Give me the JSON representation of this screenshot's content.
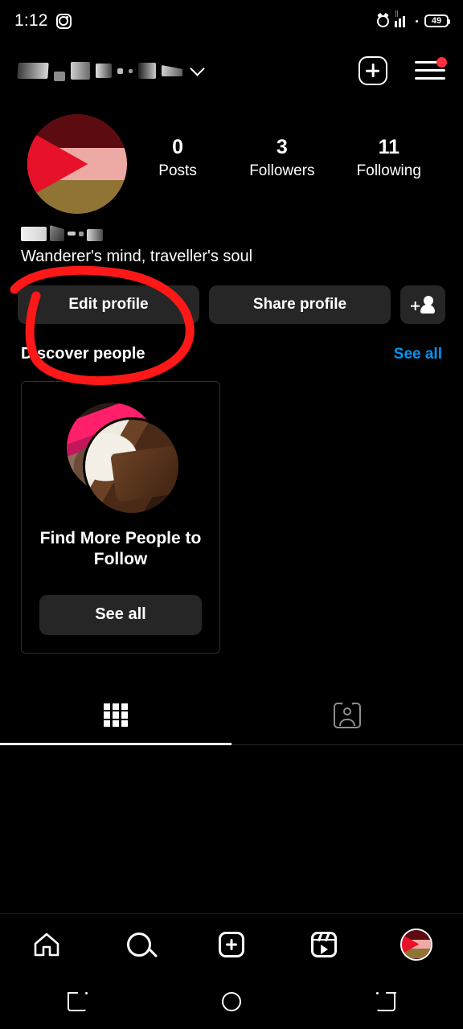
{
  "status_bar": {
    "time": "1:12",
    "app_icon": "instagram-icon",
    "alarm_icon": "alarm-clock-icon",
    "signal_icon": "signal-bars-icon",
    "signal_label": "WiFi",
    "battery_level": "49"
  },
  "header": {
    "username": "",
    "username_redacted": true,
    "chevron_icon": "chevron-down-icon",
    "add_icon": "plus-square-icon",
    "menu_icon": "hamburger-menu-icon",
    "menu_badge": true,
    "badge_color": "#ff3040"
  },
  "profile": {
    "avatar_icon": "profile-avatar",
    "avatar_colors": {
      "top": "#5c0b10",
      "middle": "#eda9a4",
      "bottom": "#8f7435",
      "triangle": "#e8112a"
    },
    "stats": [
      {
        "value": "0",
        "label": "Posts"
      },
      {
        "value": "3",
        "label": "Followers"
      },
      {
        "value": "11",
        "label": "Following"
      }
    ],
    "display_name": "",
    "display_name_redacted": true,
    "bio": "Wanderer's mind, traveller's soul"
  },
  "actions": {
    "edit_profile": "Edit profile",
    "share_profile": "Share profile",
    "add_person_icon": "person-add-icon"
  },
  "discover": {
    "title": "Discover people",
    "see_all_link": "See all",
    "see_all_color": "#0095f6",
    "card": {
      "avatar_back_icon": "suggested-user-avatar-back",
      "avatar_front_icon": "suggested-user-avatar-front",
      "title": "Find More People to Follow",
      "button_label": "See all"
    }
  },
  "tabs": [
    {
      "name": "grid-tab",
      "icon": "grid-icon",
      "active": true
    },
    {
      "name": "tagged-tab",
      "icon": "tagged-icon",
      "active": false
    }
  ],
  "bottom_nav": [
    {
      "name": "home",
      "icon": "home-icon",
      "active": false
    },
    {
      "name": "search",
      "icon": "search-icon",
      "active": false
    },
    {
      "name": "create",
      "icon": "plus-square-icon",
      "active": false
    },
    {
      "name": "reels",
      "icon": "reels-icon",
      "active": false
    },
    {
      "name": "profile",
      "icon": "avatar-icon",
      "active": true
    }
  ],
  "android_nav": [
    {
      "name": "recents",
      "icon": "recents-icon"
    },
    {
      "name": "home",
      "icon": "home-circle-icon"
    },
    {
      "name": "back",
      "icon": "back-icon"
    }
  ],
  "annotation": {
    "type": "hand-drawn-circle",
    "color": "#ff1818",
    "target": "Edit profile"
  }
}
